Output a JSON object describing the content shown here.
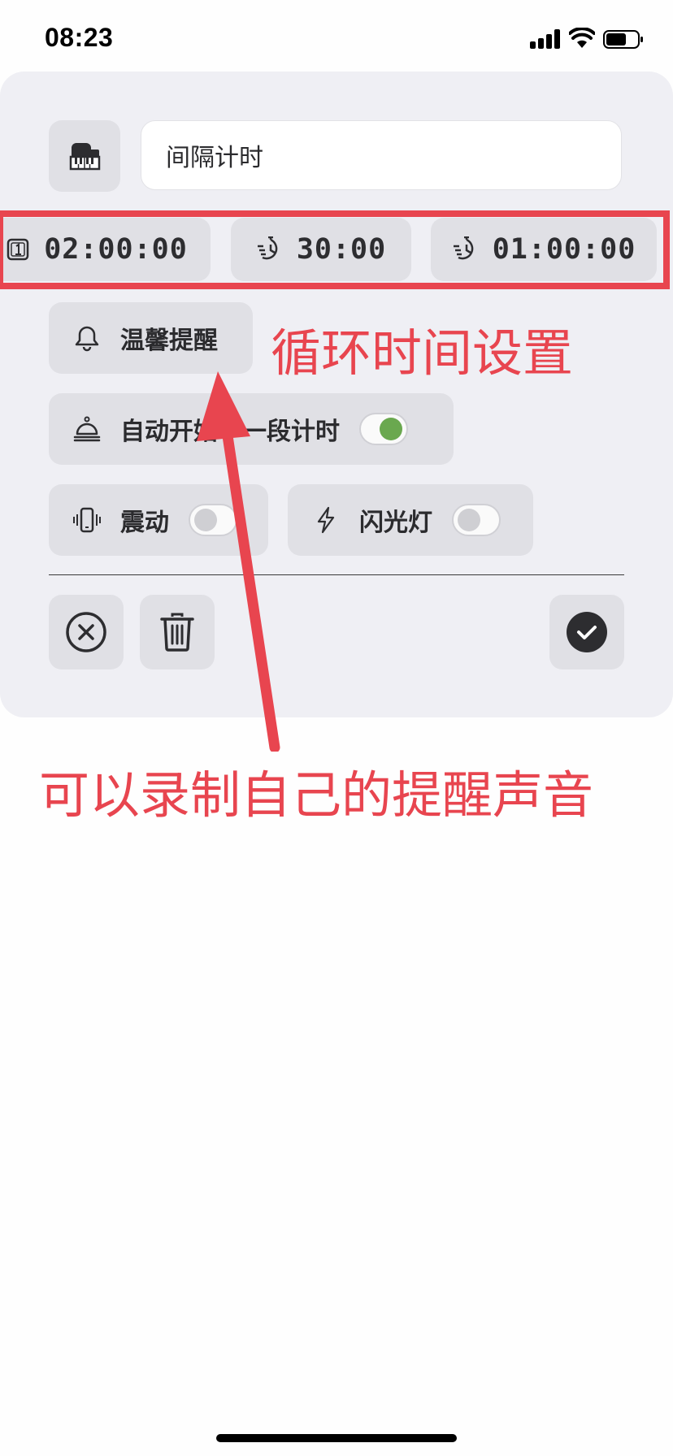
{
  "status_bar": {
    "time": "08:23"
  },
  "timer": {
    "name": "间隔计时",
    "durations": [
      {
        "value": "02:00:00",
        "icon": "repeat-count-icon"
      },
      {
        "value": "30:00",
        "icon": "interval-timer-icon"
      },
      {
        "value": "01:00:00",
        "icon": "interval-timer-icon"
      }
    ],
    "reminder_sound_label": "温馨提醒",
    "auto_start_next_label": "自动开始下一段计时",
    "auto_start_next_on": true,
    "vibrate_label": "震动",
    "vibrate_on": false,
    "flash_label": "闪光灯",
    "flash_on": false
  },
  "annotations": {
    "cycle_settings": "循环时间设置",
    "record_reminder": "可以录制自己的提醒声音"
  },
  "colors": {
    "annotation": "#e8454f",
    "toggle_on": "#6aa84f",
    "panel_bg": "#efeff4",
    "chip_bg": "#e0e0e5"
  }
}
